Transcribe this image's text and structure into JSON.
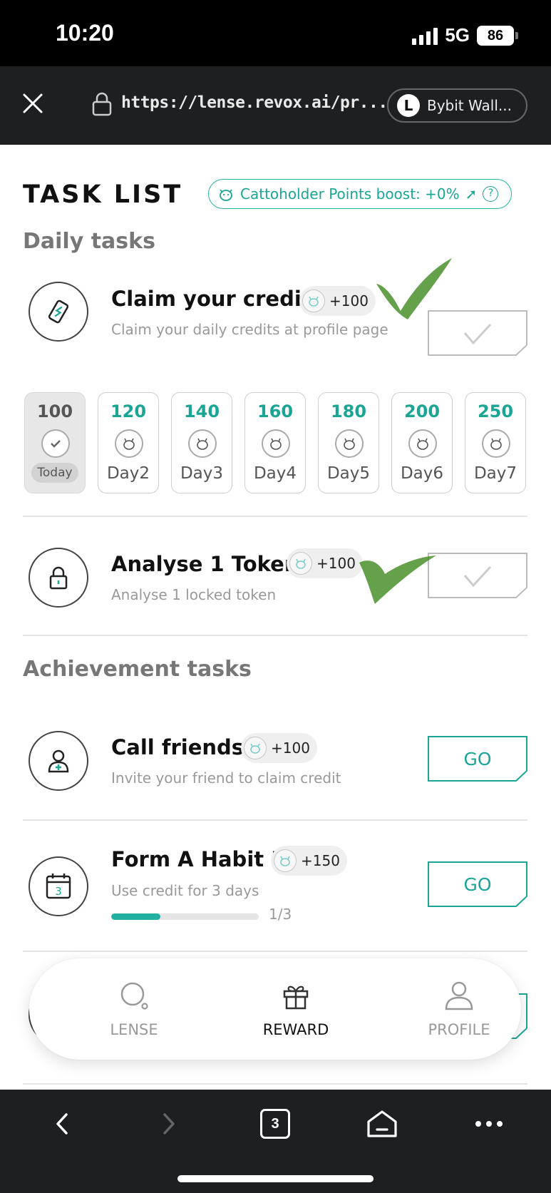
{
  "status_bar": {
    "time": "10:20",
    "network": "5G",
    "battery": "86"
  },
  "browser": {
    "url": "https://lense.revox.ai/pr...",
    "wallet_label": "Bybit Wall...",
    "wallet_logo": "L",
    "tab_count": "3"
  },
  "header": {
    "title": "TASK LIST",
    "boost_label": "Cattoholder Points boost: +0%",
    "boost_help": "?"
  },
  "daily": {
    "section_title": "Daily tasks",
    "claim": {
      "title": "Claim your credit",
      "reward": "+100",
      "description": "Claim your daily credits at profile page",
      "state": "completed"
    },
    "days": [
      {
        "value": "100",
        "label": "Today"
      },
      {
        "value": "120",
        "label": "Day2"
      },
      {
        "value": "140",
        "label": "Day3"
      },
      {
        "value": "160",
        "label": "Day4"
      },
      {
        "value": "180",
        "label": "Day5"
      },
      {
        "value": "200",
        "label": "Day6"
      },
      {
        "value": "250",
        "label": "Day7"
      }
    ],
    "analyse": {
      "title": "Analyse 1 Token",
      "reward": "+100",
      "description": "Analyse 1 locked token",
      "state": "completed"
    }
  },
  "achievement": {
    "section_title": "Achievement tasks",
    "call_friends": {
      "title": "Call friends",
      "reward": "+100",
      "description": "Invite your friend to claim credit",
      "button": "GO"
    },
    "habit": {
      "title": "Form A Habit I",
      "reward": "+150",
      "description": "Use credit for 3 days",
      "button": "GO",
      "progress_text": "1/3",
      "progress_fraction": 0.333,
      "calendar_day": "3"
    }
  },
  "tab_bar": {
    "items": [
      {
        "label": "LENSE",
        "icon": "search-icon"
      },
      {
        "label": "REWARD",
        "icon": "gift-icon"
      },
      {
        "label": "PROFILE",
        "icon": "user-icon"
      }
    ],
    "active": "REWARD"
  },
  "colors": {
    "accent": "#1aa595",
    "check_mark": "#4a8f2a"
  }
}
